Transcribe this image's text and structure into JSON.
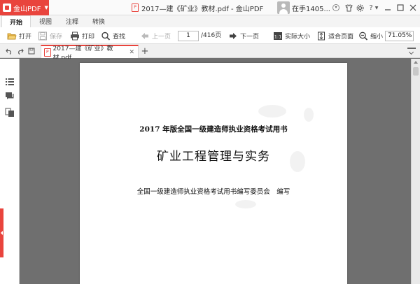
{
  "titlebar": {
    "app_name": "金山PDF",
    "window_title": "2017—建《矿业》教材.pdf - 金山PDF",
    "user_name": "在手1405..."
  },
  "ribbon": {
    "tabs": [
      {
        "label": "开始",
        "active": true
      },
      {
        "label": "视图",
        "active": false
      },
      {
        "label": "注释",
        "active": false
      },
      {
        "label": "转换",
        "active": false
      }
    ]
  },
  "toolbar": {
    "open": "打开",
    "save": "保存",
    "print": "打印",
    "find": "查找",
    "prev_page": "上一页",
    "page_current": "1",
    "page_total": "/416页",
    "next_page": "下一页",
    "actual_size": "实际大小",
    "fit_page": "适合页面",
    "zoom_out": "缩小",
    "zoom_value": "71.05%"
  },
  "doc_tab": {
    "title": "2017—建《矿业》教材.pdf"
  },
  "page": {
    "series": "2017 年版全国一级建造师执业资格考试用书",
    "title": "矿业工程管理与实务",
    "author": "全国一级建造师执业资格考试用书编写委员会　编写"
  },
  "colors": {
    "brand": "#e9443d",
    "workspace": "#6f6f6f"
  }
}
